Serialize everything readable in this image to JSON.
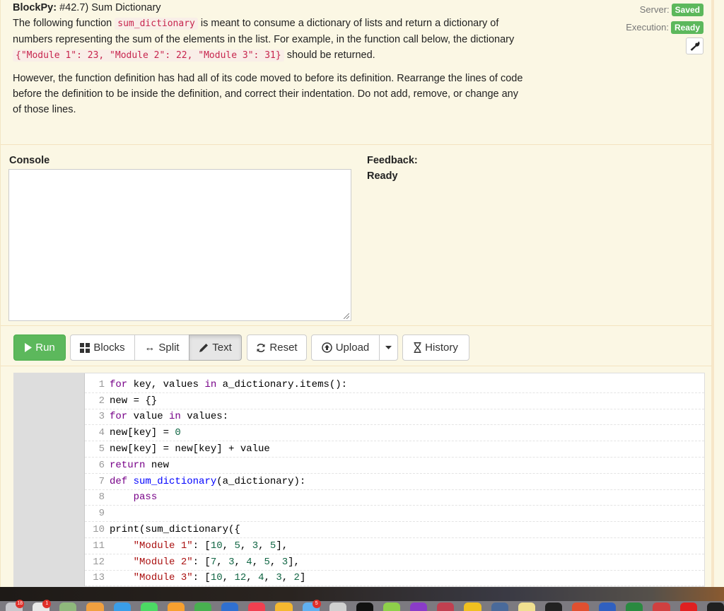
{
  "header": {
    "title_prefix": "BlockPy:",
    "title": "#42.7) Sum Dictionary",
    "instructions": {
      "p1_part1": "The following function ",
      "p1_code1": "sum_dictionary",
      "p1_part2": " is meant to consume a dictionary of lists and return a dictionary of numbers representing the sum of the elements in the list. For example, in the function call below, the dictionary ",
      "p1_code2": "{\"Module 1\": 23, \"Module 2\": 22, \"Module 3\": 31}",
      "p1_part3": " should be returned.",
      "p2": "However, the function definition has had all of its code moved to before its definition. Rearrange the lines of code before the definition to be inside the definition, and correct their indentation. Do not add, remove, or change any of those lines."
    },
    "status": {
      "server_label": "Server:",
      "server_value": "Saved",
      "execution_label": "Execution:",
      "execution_value": "Ready",
      "badge_color": "#5cb85c"
    }
  },
  "console": {
    "label": "Console",
    "content": ""
  },
  "feedback": {
    "label": "Feedback:",
    "value": "Ready"
  },
  "toolbar": {
    "run": "Run",
    "blocks": "Blocks",
    "split": "Split",
    "text": "Text",
    "reset": "Reset",
    "upload": "Upload",
    "history": "History",
    "active_mode": "Text",
    "run_color": "#5cb85c"
  },
  "editor": {
    "lines": [
      {
        "n": "1",
        "code": "for key, values in a_dictionary.items():"
      },
      {
        "n": "2",
        "code": "new = {}"
      },
      {
        "n": "3",
        "code": "for value in values:"
      },
      {
        "n": "4",
        "code": "new[key] = 0"
      },
      {
        "n": "5",
        "code": "new[key] = new[key] + value"
      },
      {
        "n": "6",
        "code": "return new"
      },
      {
        "n": "7",
        "code": "def sum_dictionary(a_dictionary):"
      },
      {
        "n": "8",
        "code": "    pass"
      },
      {
        "n": "9",
        "code": ""
      },
      {
        "n": "10",
        "code": "print(sum_dictionary({"
      },
      {
        "n": "11",
        "code": "    \"Module 1\": [10, 5, 3, 5],"
      },
      {
        "n": "12",
        "code": "    \"Module 2\": [7, 3, 4, 5, 3],"
      },
      {
        "n": "13",
        "code": "    \"Module 3\": [10, 12, 4, 3, 2]"
      }
    ]
  },
  "dock": {
    "badges": [
      "18",
      "1",
      "5"
    ]
  }
}
